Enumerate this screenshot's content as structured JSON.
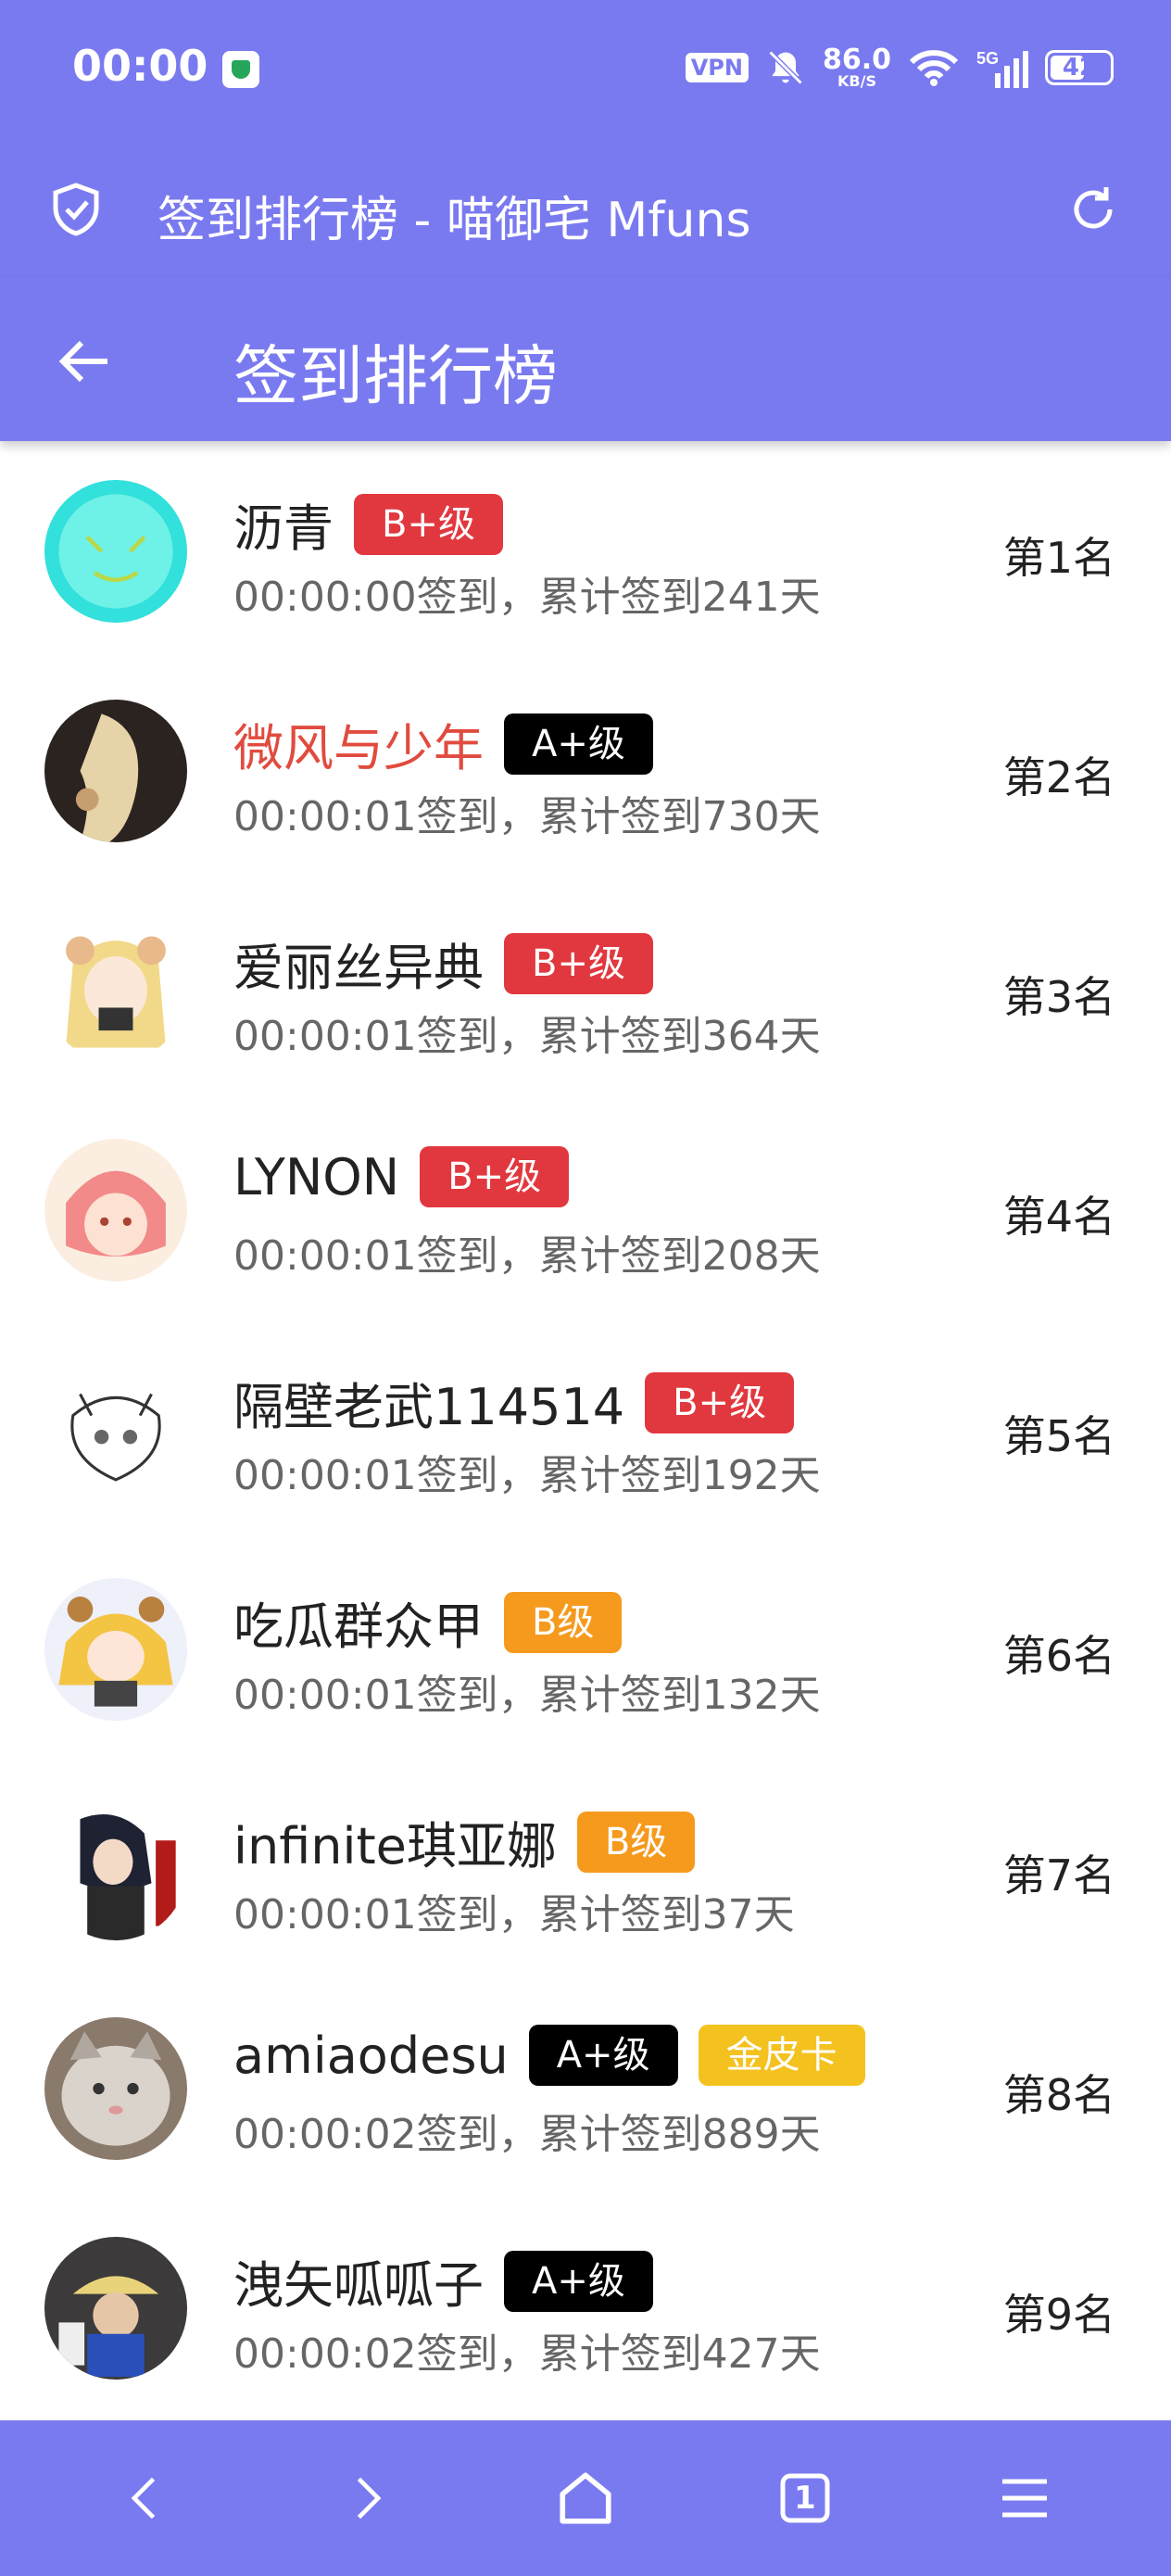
{
  "status_bar": {
    "time": "00:00",
    "vpn": "VPN",
    "speed": "86.0",
    "speed_unit": "KB/S",
    "network": "5G",
    "battery": "42"
  },
  "browser": {
    "page_title": "签到排行榜 - 喵御宅 Mfuns",
    "tab_count": "1"
  },
  "app_bar": {
    "title": "签到排行榜"
  },
  "colors": {
    "theme": "#7a7af0",
    "badge_red": "#e1383f",
    "badge_black": "#000000",
    "badge_orange": "#f59a1d",
    "badge_gold": "#f4c21f",
    "name_highlight": "#e14b3f"
  },
  "rows": [
    {
      "name": "沥青",
      "badges": [
        {
          "text": "B+级",
          "style": "red"
        }
      ],
      "sub": "00:00:00签到，累计签到241天",
      "rank": "第1名",
      "avatar": "teal-cat-avatar"
    },
    {
      "name": "微风与少年",
      "name_style": "red",
      "badges": [
        {
          "text": "A+级",
          "style": "black"
        }
      ],
      "sub": "00:00:01签到，累计签到730天",
      "rank": "第2名",
      "avatar": "dark-art-avatar"
    },
    {
      "name": "爱丽丝异典",
      "badges": [
        {
          "text": "B+级",
          "style": "red"
        }
      ],
      "sub": "00:00:01签到，累计签到364天",
      "rank": "第3名",
      "avatar": "blonde-chibi-avatar"
    },
    {
      "name": "LYNON",
      "badges": [
        {
          "text": "B+级",
          "style": "red"
        }
      ],
      "sub": "00:00:01签到，累计签到208天",
      "rank": "第4名",
      "avatar": "pink-hair-avatar"
    },
    {
      "name": "隔壁老武114514",
      "badges": [
        {
          "text": "B+级",
          "style": "red"
        }
      ],
      "sub": "00:00:01签到，累计签到192天",
      "rank": "第5名",
      "avatar": "sketch-cat-avatar"
    },
    {
      "name": "吃瓜群众甲",
      "badges": [
        {
          "text": "B级",
          "style": "orange"
        }
      ],
      "sub": "00:00:01签到，累计签到132天",
      "rank": "第6名",
      "avatar": "yellow-chibi-avatar"
    },
    {
      "name": "infinite琪亚娜",
      "badges": [
        {
          "text": "B级",
          "style": "orange"
        }
      ],
      "sub": "00:00:01签到，累计签到37天",
      "rank": "第7名",
      "avatar": "dark-hair-avatar"
    },
    {
      "name": "amiaodesu",
      "badges": [
        {
          "text": "A+级",
          "style": "black"
        },
        {
          "text": "金皮卡",
          "style": "gold"
        }
      ],
      "sub": "00:00:02签到，累计签到889天",
      "rank": "第8名",
      "avatar": "cat-photo-avatar"
    },
    {
      "name": "洩矢呱呱子",
      "badges": [
        {
          "text": "A+级",
          "style": "black"
        }
      ],
      "sub": "00:00:02签到，累计签到427天",
      "rank": "第9名",
      "avatar": "figure-photo-avatar"
    }
  ]
}
